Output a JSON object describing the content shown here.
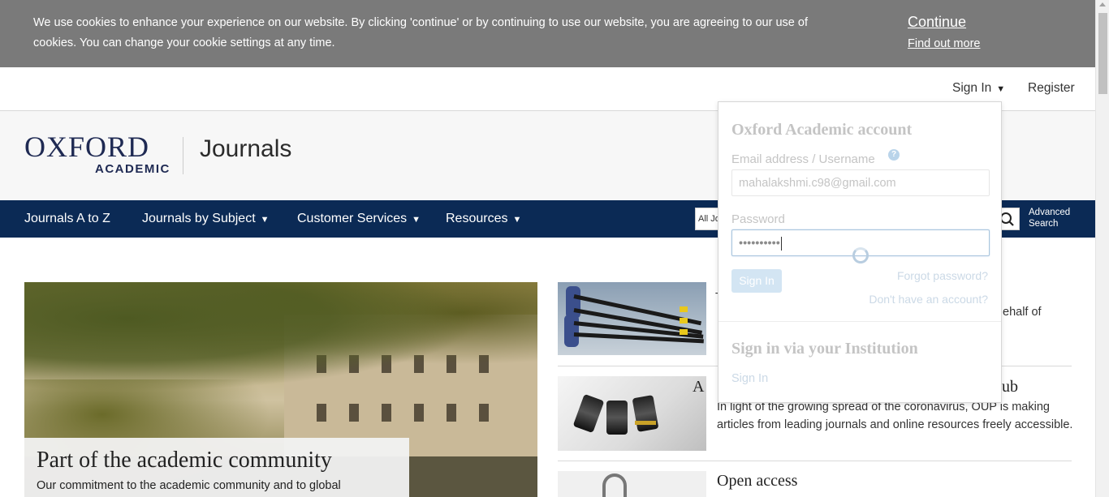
{
  "cookie_banner": {
    "text": "We use cookies to enhance your experience on our website. By clicking 'continue' or by continuing to use our website, you are agreeing to our use of cookies. You can change your cookie settings at any time.",
    "continue_label": "Continue",
    "find_out_more_label": "Find out more"
  },
  "util_bar": {
    "sign_in_label": "Sign In",
    "caret": "▼",
    "register_label": "Register"
  },
  "header": {
    "logo_main": "OXFORD",
    "logo_sub": "ACADEMIC",
    "site_name": "Journals"
  },
  "nav": {
    "items": [
      {
        "label": "Journals A to Z",
        "caret": ""
      },
      {
        "label": "Journals by Subject",
        "caret": "▼"
      },
      {
        "label": "Customer Services",
        "caret": "▼"
      },
      {
        "label": "Resources",
        "caret": "▼"
      }
    ],
    "search_scope": "All Jo",
    "advanced_search_line1": "Advanced",
    "advanced_search_line2": "Search"
  },
  "hero": {
    "title": "Part of the academic community",
    "subtitle": "Our commitment to the academic community and to global"
  },
  "articles": [
    {
      "partial_text": "ehalf of",
      "partial_lead": "T"
    },
    {
      "title_partial": "ub",
      "title_lead": "A",
      "text_line1": "In light of the growing spread of the coronavirus, OUP is making",
      "text_line2": "articles from leading journals and online resources freely accessible."
    },
    {
      "title": "Open access"
    }
  ],
  "signin_panel": {
    "title": "Oxford Academic account",
    "email_label": "Email address / Username",
    "help_glyph": "?",
    "email_value": "mahalakshmi.c98@gmail.com",
    "password_label": "Password",
    "password_value": "••••••••••",
    "signin_button": "Sign In",
    "forgot_password": "Forgot password?",
    "no_account": "Don't have an account?",
    "institution_title": "Sign in via your Institution",
    "institution_signin": "Sign In"
  }
}
